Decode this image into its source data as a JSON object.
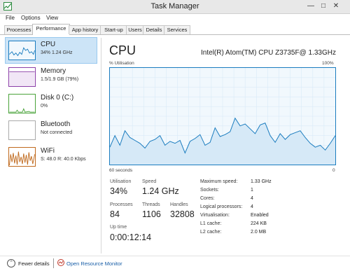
{
  "window": {
    "title": "Task Manager"
  },
  "menu": {
    "items": [
      "File",
      "Options",
      "View"
    ]
  },
  "tabs": [
    "Processes",
    "Performance",
    "App history",
    "Start-up",
    "Users",
    "Details",
    "Services"
  ],
  "sidebar": {
    "items": [
      {
        "title": "CPU",
        "subtitle": "34% 1.24 GHz",
        "color": "#1a7cbf"
      },
      {
        "title": "Memory",
        "subtitle": "1.5/1.9 GB (79%)",
        "color": "#8b3fa8"
      },
      {
        "title": "Disk 0 (C:)",
        "subtitle": "0%",
        "color": "#4aa33a"
      },
      {
        "title": "Bluetooth",
        "subtitle": "Not connected",
        "color": "#aaaaaa"
      },
      {
        "title": "WiFi",
        "subtitle": "S: 48.0  R: 40.0 Kbps",
        "color": "#c06a1e"
      }
    ]
  },
  "main": {
    "title": "CPU",
    "model": "Intel(R) Atom(TM) CPU Z3735F@ 1.33GHz",
    "graph_label": "% Utilisation",
    "graph_max": "100%",
    "graph_time": "60 seconds",
    "graph_min": "0",
    "stats": {
      "utilisation_label": "Utilisation",
      "utilisation": "34%",
      "speed_label": "Speed",
      "speed": "1.24 GHz",
      "processes_label": "Processes",
      "processes": "84",
      "threads_label": "Threads",
      "threads": "1106",
      "handles_label": "Handles",
      "handles": "32808",
      "uptime_label": "Up time",
      "uptime": "0:00:12:14"
    },
    "details": [
      {
        "label": "Maximum speed:",
        "value": "1.33 GHz"
      },
      {
        "label": "Sockets:",
        "value": "1"
      },
      {
        "label": "Cores:",
        "value": "4"
      },
      {
        "label": "Logical processors:",
        "value": "4"
      },
      {
        "label": "Virtualisation:",
        "value": "Enabled"
      },
      {
        "label": "L1 cache:",
        "value": "224 KB"
      },
      {
        "label": "L2 cache:",
        "value": "2.0 MB"
      }
    ]
  },
  "footer": {
    "fewer_details": "Fewer details",
    "open_resource_monitor": "Open Resource Monitor"
  },
  "colors": {
    "accent": "#1a7cbf",
    "graph_bg": "#f1f8fd",
    "selected": "#cce4f7"
  },
  "cpu_history": [
    18,
    30,
    20,
    35,
    28,
    25,
    22,
    17,
    24,
    26,
    30,
    20,
    24,
    22,
    25,
    12,
    24,
    27,
    31,
    20,
    23,
    38,
    29,
    31,
    34,
    48,
    40,
    42,
    37,
    32,
    41,
    43,
    30,
    23,
    32,
    26,
    31,
    33,
    35,
    28,
    22,
    18,
    20,
    15,
    22,
    30
  ]
}
